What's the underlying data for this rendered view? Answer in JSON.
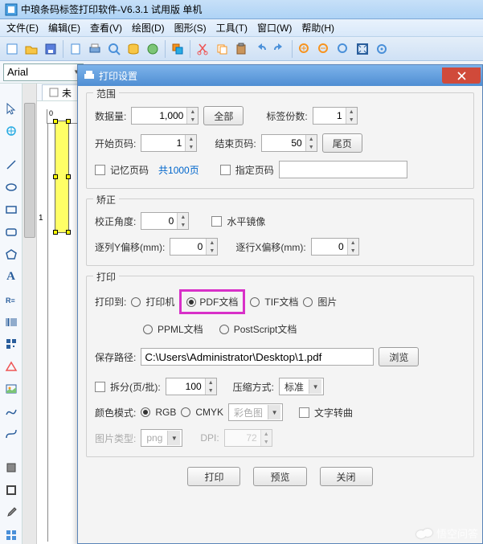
{
  "app": {
    "title": "中琅条码标签打印软件-V6.3.1 试用版 单机"
  },
  "menu": {
    "file": "文件(E)",
    "edit": "编辑(E)",
    "view": "查看(V)",
    "draw": "绘图(D)",
    "shape": "图形(S)",
    "tool": "工具(T)",
    "window": "窗口(W)",
    "help": "帮助(H)"
  },
  "font": {
    "family": "Arial"
  },
  "tab": {
    "label": "未"
  },
  "dialog": {
    "title": "打印设置",
    "range": {
      "title": "范围",
      "data_amount_lbl": "数据量:",
      "data_amount": "1,000",
      "all_btn": "全部",
      "copies_lbl": "标签份数:",
      "copies": "1",
      "start_lbl": "开始页码:",
      "start": "1",
      "end_lbl": "结束页码:",
      "end": "50",
      "last_btn": "尾页",
      "remember_lbl": "记忆页码",
      "total_pages": "共1000页",
      "specify_lbl": "指定页码"
    },
    "adjust": {
      "title": "矫正",
      "angle_lbl": "校正角度:",
      "angle": "0",
      "mirror_lbl": "水平镜像",
      "y_off_lbl": "逐列Y偏移(mm):",
      "y_off": "0",
      "x_off_lbl": "逐行X偏移(mm):",
      "x_off": "0"
    },
    "print": {
      "title": "打印",
      "to_lbl": "打印到:",
      "opt_printer": "打印机",
      "opt_pdf": "PDF文档",
      "opt_tif": "TIF文档",
      "opt_img": "图片",
      "opt_ppml": "PPML文档",
      "opt_ps": "PostScript文档",
      "path_lbl": "保存路径:",
      "path": "C:\\Users\\Administrator\\Desktop\\1.pdf",
      "browse_btn": "浏览",
      "split_lbl": "拆分(页/批):",
      "split": "100",
      "compress_lbl": "压缩方式:",
      "compress": "标准",
      "color_lbl": "颜色模式:",
      "opt_rgb": "RGB",
      "opt_cmyk": "CMYK",
      "colormap": "彩色图",
      "text_rotate_lbl": "文字转曲",
      "imgtype_lbl": "图片类型:",
      "imgtype": "png",
      "dpi_lbl": "DPI:",
      "dpi": "72"
    },
    "buttons": {
      "print": "打印",
      "preview": "预览",
      "close": "关闭"
    }
  },
  "watermark": "悟空问答"
}
